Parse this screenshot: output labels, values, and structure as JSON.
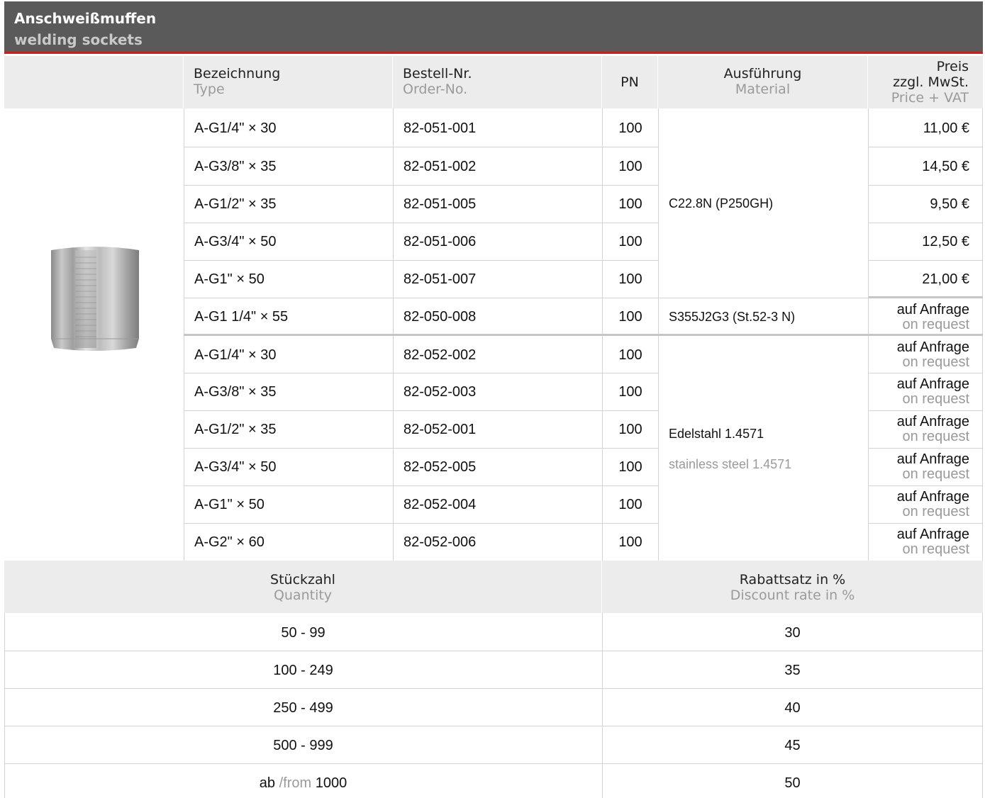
{
  "header": {
    "title_de": "Anschweißmuffen",
    "title_en": "welding sockets"
  },
  "columns": {
    "type_de": "Bezeichnung",
    "type_en": "Type",
    "order_de": "Bestell-Nr.",
    "order_en": "Order-No.",
    "pn": "PN",
    "material_de": "Ausführung",
    "material_en": "Material",
    "price_de1": "Preis",
    "price_de2": "zzgl. MwSt.",
    "price_en": "Price + VAT"
  },
  "rows": [
    {
      "type": "A-G1/4\" × 30",
      "order": "82-051-001",
      "pn": "100",
      "price": "11,00 €"
    },
    {
      "type": "A-G3/8\" × 35",
      "order": "82-051-002",
      "pn": "100",
      "price": "14,50 €"
    },
    {
      "type": "A-G1/2\" × 35",
      "order": "82-051-005",
      "pn": "100",
      "price": "9,50 €"
    },
    {
      "type": "A-G3/4\" × 50",
      "order": "82-051-006",
      "pn": "100",
      "price": "12,50 €"
    },
    {
      "type": "A-G1\" × 50",
      "order": "82-051-007",
      "pn": "100",
      "price": "21,00 €"
    },
    {
      "type": "A-G1 1/4\" × 55",
      "order": "82-050-008",
      "pn": "100",
      "price_de": "auf Anfrage",
      "price_en": "on request"
    },
    {
      "type": "A-G1/4\" × 30",
      "order": "82-052-002",
      "pn": "100",
      "price_de": "auf Anfrage",
      "price_en": "on request"
    },
    {
      "type": "A-G3/8\" × 35",
      "order": "82-052-003",
      "pn": "100",
      "price_de": "auf Anfrage",
      "price_en": "on request"
    },
    {
      "type": "A-G1/2\" × 35",
      "order": "82-052-001",
      "pn": "100",
      "price_de": "auf Anfrage",
      "price_en": "on request"
    },
    {
      "type": "A-G3/4\" × 50",
      "order": "82-052-005",
      "pn": "100",
      "price_de": "auf Anfrage",
      "price_en": "on request"
    },
    {
      "type": "A-G1\" × 50",
      "order": "82-052-004",
      "pn": "100",
      "price_de": "auf Anfrage",
      "price_en": "on request"
    },
    {
      "type": "A-G2\" × 60",
      "order": "82-052-006",
      "pn": "100",
      "price_de": "auf Anfrage",
      "price_en": "on request"
    }
  ],
  "materials": {
    "m1": "C22.8N (P250GH)",
    "m2": "S355J2G3 (St.52-3 N)",
    "m3_de": "Edelstahl 1.4571",
    "m3_en": "stainless steel 1.4571"
  },
  "discount": {
    "qty_de": "Stückzahl",
    "qty_en": "Quantity",
    "rate_de": "Rabattsatz in %",
    "rate_en": "Discount rate in %",
    "rows": [
      {
        "qty": "50 - 99",
        "rate": "30"
      },
      {
        "qty": "100 - 249",
        "rate": "35"
      },
      {
        "qty": "250 - 499",
        "rate": "40"
      },
      {
        "qty": "500 - 999",
        "rate": "45"
      },
      {
        "qty_prefix": "ab",
        "qty_mid": "/from",
        "qty_num": "1000",
        "rate": "50"
      }
    ]
  },
  "product_image": {
    "icon": "welding-socket-photo"
  },
  "colors": {
    "header_bg": "#5a5a5a",
    "accent": "#c8201e",
    "row_header_bg": "#ececec",
    "muted_text": "#9a9a9a"
  }
}
